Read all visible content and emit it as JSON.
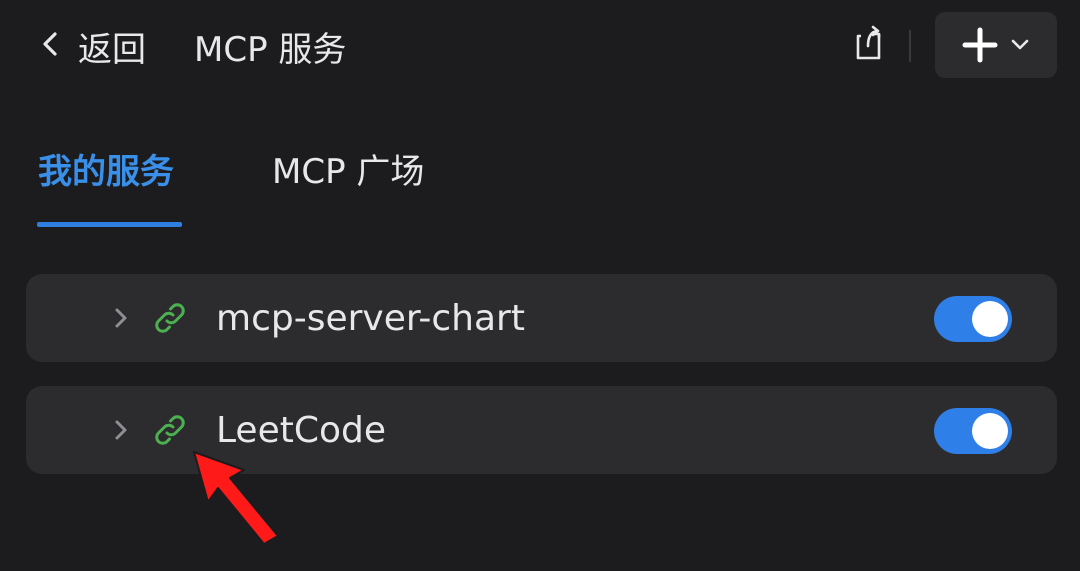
{
  "header": {
    "back_label": "返回",
    "title": "MCP 服务",
    "icons": {
      "back": "chevron-left-icon",
      "share": "share-icon",
      "add": "plus-icon",
      "add_menu": "chevron-down-icon"
    }
  },
  "tabs": [
    {
      "label": "我的服务",
      "active": true
    },
    {
      "label": "MCP 广场",
      "active": false
    }
  ],
  "servers": [
    {
      "name": "mcp-server-chart",
      "enabled": true,
      "icon": "link-icon"
    },
    {
      "name": "LeetCode",
      "enabled": true,
      "icon": "link-icon"
    }
  ],
  "colors": {
    "background": "#1c1c1e",
    "card": "#2c2c2e",
    "accent": "#2f7fe8",
    "link_icon": "#4caf50",
    "annotation": "#ff1a1a"
  }
}
